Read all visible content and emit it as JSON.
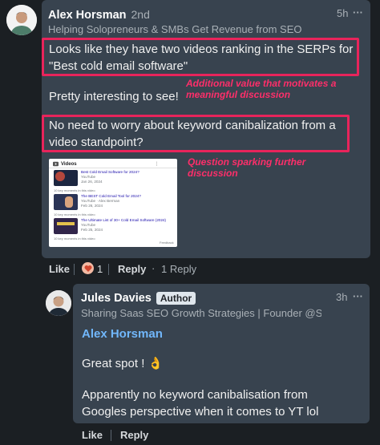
{
  "comment": {
    "author": "Alex Horsman",
    "time_ago": "2nd",
    "headline": "Helping Solopreneurs & SMBs Get Revenue from SEO",
    "age": "5h",
    "paragraph1": "Looks like they have two videos ranking in the SERPs for \"Best cold email software\"",
    "paragraph2": "Pretty interesting to see!",
    "paragraph3": "No need to worry about keyword canibalization from a video standpoint?",
    "annotation1": "Additional value that motivates a meaningful discussion",
    "annotation2": "Question sparking further discussion",
    "embedded": {
      "header": "Videos",
      "items": [
        {
          "title": "Best Cold Email Software for 2024?",
          "channel": "YouTube",
          "date": "Jan 26, 2024",
          "moment": "10 key moments in this video"
        },
        {
          "title": "The BEST Cold Email Tool for 2024?",
          "channel": "YouTube · Alex Berman",
          "date": "Feb 26, 2024",
          "moment": "10 key moments in this video"
        },
        {
          "title": "The Ultimate List of 30+ Cold Email Software (2024)",
          "channel": "YouTube",
          "date": "Feb 25, 2024",
          "moment": "10 key moments in this video"
        }
      ],
      "footer": "Feedback"
    },
    "actions": {
      "like": "Like",
      "reaction_count": "1",
      "reply": "Reply",
      "replies": "1 Reply"
    },
    "more": "···"
  },
  "reply": {
    "author": "Jules Davies",
    "badge": "Author",
    "headline": "Sharing Saas SEO Growth Strategies | Founder @Sca...",
    "age": "3h",
    "mention": "Alex Horsman",
    "paragraph1": "Great spot ! 👌",
    "paragraph2": "Apparently no keyword canibalisation from Googles perspective when it comes to YT lol",
    "actions": {
      "like": "Like",
      "reply": "Reply"
    },
    "more": "···"
  },
  "colors": {
    "highlight": "#e8245b",
    "annotation": "#ff2e6a",
    "mention": "#71b7fb",
    "card": "#38434f"
  }
}
